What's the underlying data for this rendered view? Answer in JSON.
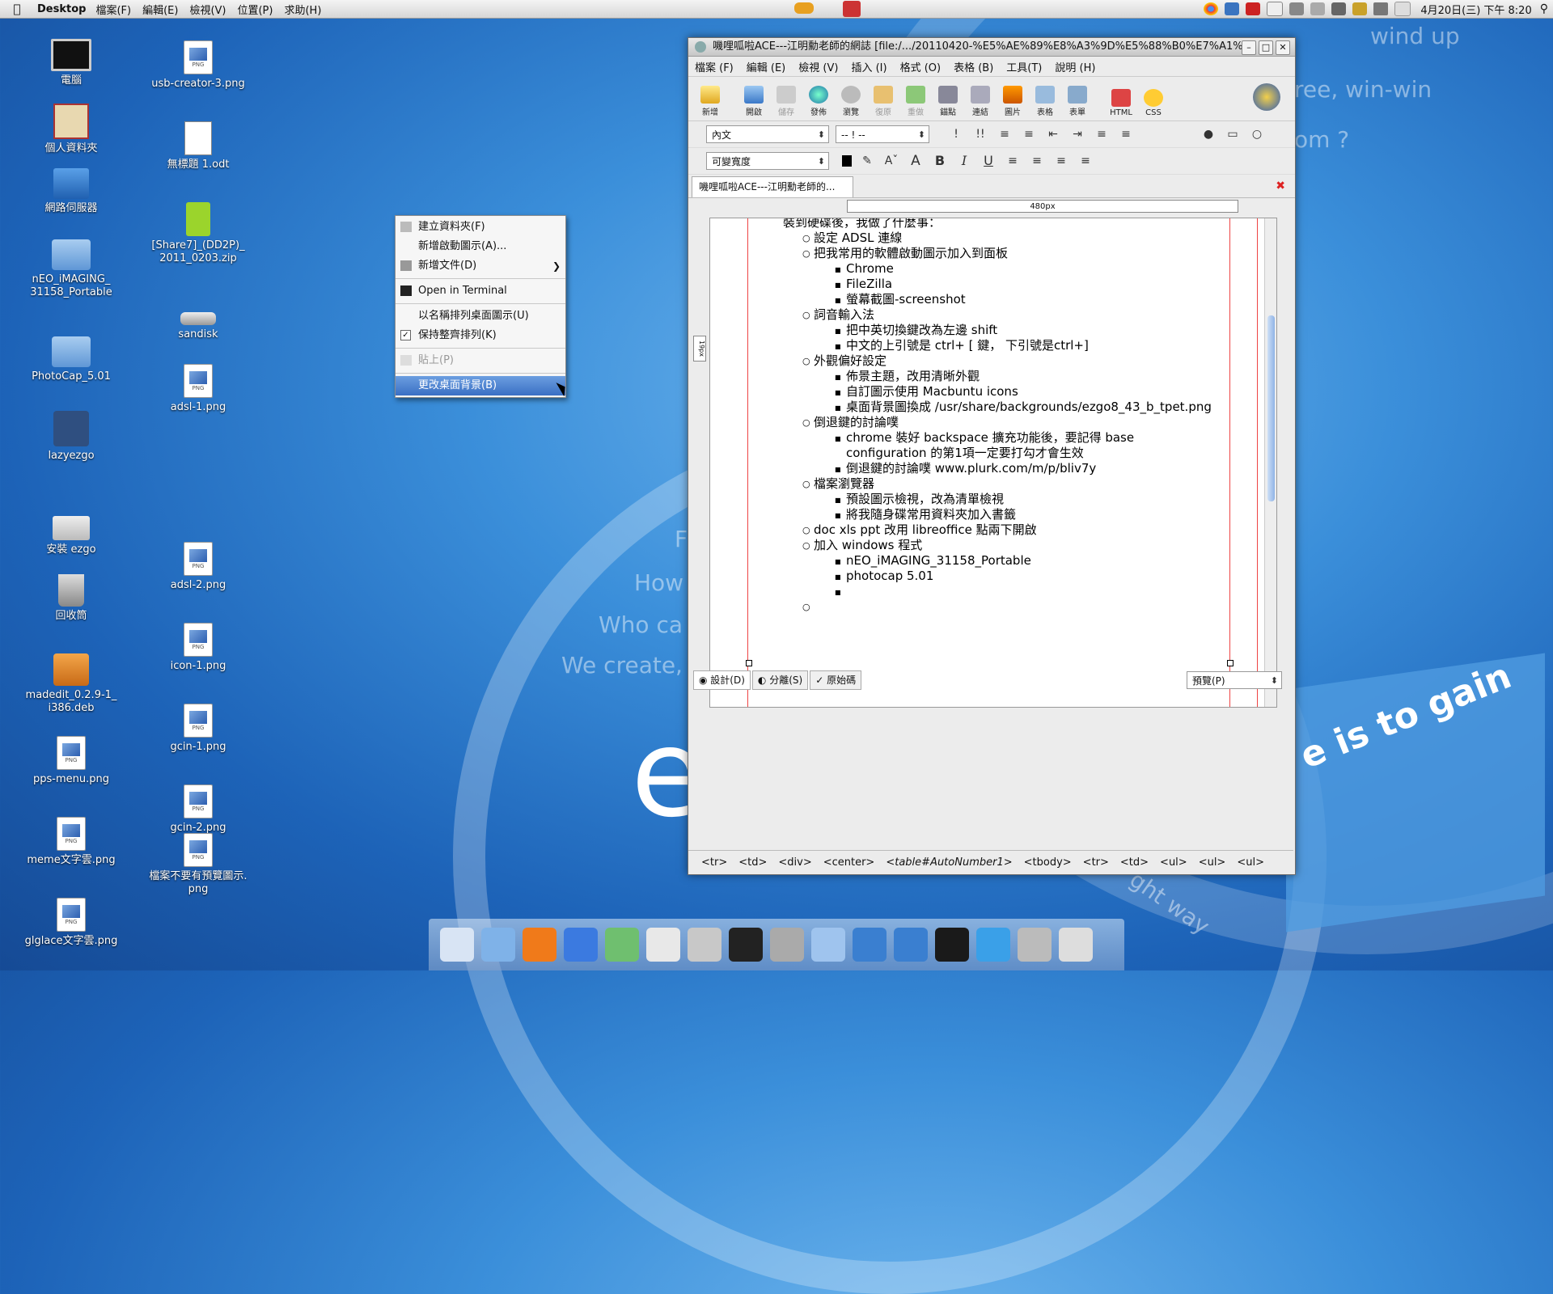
{
  "menubar": {
    "app": "Desktop",
    "items": [
      "檔案(F)",
      "編輯(E)",
      "檢視(V)",
      "位置(P)",
      "求助(H)"
    ],
    "clock": "4月20日(三) 下午 8:20"
  },
  "wallpaper": {
    "lines": [
      "wind up",
      "ree, win-win",
      "om ?",
      "F",
      "How",
      "Who ca",
      "We create,",
      "ght way"
    ],
    "big_letter": "e",
    "block_text": "e is to gain"
  },
  "desktop_icons": [
    {
      "label": "電腦",
      "icon": "monitor"
    },
    {
      "label": "個人資料夾",
      "icon": "home"
    },
    {
      "label": "網路伺服器",
      "icon": "network"
    },
    {
      "label": "nEO_iMAGING_\n31158_Portable",
      "icon": "folder"
    },
    {
      "label": "PhotoCap_5.01",
      "icon": "folder"
    },
    {
      "label": "lazyezgo",
      "icon": "lazy"
    },
    {
      "label": "安裝 ezgo",
      "icon": "install"
    },
    {
      "label": "回收筒",
      "icon": "trash"
    },
    {
      "label": "madedit_0.2.9-1_\ni386.deb",
      "icon": "pkg"
    },
    {
      "label": "pps-menu.png",
      "icon": "png"
    },
    {
      "label": "meme文字雲.png",
      "icon": "png"
    },
    {
      "label": "glglace文字雲.png",
      "icon": "png"
    },
    {
      "label": "usb-creator-3.png",
      "icon": "png"
    },
    {
      "label": "無標題 1.odt",
      "icon": "doc"
    },
    {
      "label": "[Share7]_(DD2P)_\n2011_0203.zip",
      "icon": "zip"
    },
    {
      "label": "sandisk",
      "icon": "usb"
    },
    {
      "label": "adsl-1.png",
      "icon": "png"
    },
    {
      "label": "adsl-2.png",
      "icon": "png"
    },
    {
      "label": "icon-1.png",
      "icon": "png"
    },
    {
      "label": "gcin-1.png",
      "icon": "png"
    },
    {
      "label": "gcin-2.png",
      "icon": "png"
    },
    {
      "label": "檔案不要有預覽圖示.\npng",
      "icon": "png"
    }
  ],
  "context_menu": {
    "items": [
      {
        "label": "建立資料夾(F)"
      },
      {
        "label": "新增啟動圖示(A)..."
      },
      {
        "label": "新增文件(D)"
      },
      {
        "label": "Open in Terminal"
      },
      {
        "label": "以名稱排列桌面圖示(U)"
      },
      {
        "label": "保持整齊排列(K)"
      },
      {
        "label": "貼上(P)"
      },
      {
        "label": "更改桌面背景(B)"
      }
    ]
  },
  "editor_window": {
    "title": "嘰哩呱啦ACE---江明勳老師的網誌 [file:/.../20110420-%E5%AE%89%E8%A3%9D%E5%88%B0%E7%A1%",
    "menu": [
      "檔案 (F)",
      "編輯 (E)",
      "檢視 (V)",
      "插入 (I)",
      "格式 (O)",
      "表格 (B)",
      "工具(T)",
      "說明 (H)"
    ],
    "toolbar": [
      "新增",
      "開啟",
      "儲存",
      "發佈",
      "瀏覽",
      "復原",
      "重做",
      "錨點",
      "連結",
      "圖片",
      "表格",
      "表單",
      "HTML",
      "CSS"
    ],
    "paragraph_style": "內文",
    "list_style": "-- ! --",
    "font": "可變寬度",
    "tab_title": "嘰哩呱啦ACE---江明勳老師的...",
    "ruler": "480px",
    "side_ruler": "19px",
    "content": [
      {
        "level": 0,
        "text": "裝到硬碟後，我做了什麼事："
      },
      {
        "level": 1,
        "text": "設定 ADSL 連線"
      },
      {
        "level": 1,
        "text": "把我常用的軟體啟動圖示加入到面板"
      },
      {
        "level": 2,
        "text": "Chrome"
      },
      {
        "level": 2,
        "text": "FileZilla"
      },
      {
        "level": 2,
        "text": "螢幕截圖-screenshot"
      },
      {
        "level": 1,
        "text": "詞音輸入法"
      },
      {
        "level": 2,
        "text": "把中英切換鍵改為左邊 shift"
      },
      {
        "level": 2,
        "text": "中文的上引號是 ctrl+ [ 鍵，  下引號是ctrl+]"
      },
      {
        "level": 1,
        "text": "外觀偏好設定"
      },
      {
        "level": 2,
        "text": "佈景主題，改用清晰外觀"
      },
      {
        "level": 2,
        "text": "自訂圖示使用 Macbuntu icons"
      },
      {
        "level": 2,
        "text": "桌面背景圖換成 /usr/share/backgrounds/ezgo8_43_b_tpet.png"
      },
      {
        "level": 1,
        "text": "倒退鍵的討論噗"
      },
      {
        "level": 2,
        "text": "chrome 裝好 backspace 擴充功能後，要記得 base"
      },
      {
        "level": 3,
        "text": "configuration 的第1項一定要打勾才會生效"
      },
      {
        "level": 2,
        "text": "倒退鍵的討論噗 www.plurk.com/m/p/bliv7y"
      },
      {
        "level": 1,
        "text": "檔案瀏覽器"
      },
      {
        "level": 2,
        "text": "預設圖示檢視，改為清單檢視"
      },
      {
        "level": 2,
        "text": "將我隨身碟常用資料夾加入書籤"
      },
      {
        "level": 1,
        "text": "doc xls ppt 改用 libreoffice 點兩下開啟"
      },
      {
        "level": 1,
        "text": "加入 windows 程式"
      },
      {
        "level": 2,
        "text": "nEO_iMAGING_31158_Portable"
      },
      {
        "level": 2,
        "text": "photocap 5.01"
      },
      {
        "level": 2,
        "text": ""
      },
      {
        "level": 1,
        "text": ""
      }
    ],
    "modes": [
      "設計(D)",
      "分離(S)",
      "原始碼"
    ],
    "preview": "預覽(P)",
    "tagbar": [
      "<tr>",
      "<td>",
      "<div>",
      "<center>",
      "<table#AutoNumber1>",
      "<tbody>",
      "<tr>",
      "<td>",
      "<ul>",
      "<ul>",
      "<ul>"
    ]
  },
  "dock": {
    "items": [
      "anchor",
      "finder",
      "firefox",
      "itunes",
      "feather",
      "document",
      "calculator",
      "terminal",
      "settings",
      "folder",
      "windows",
      "windows2",
      "monitor",
      "kz",
      "trash",
      "mail"
    ]
  }
}
